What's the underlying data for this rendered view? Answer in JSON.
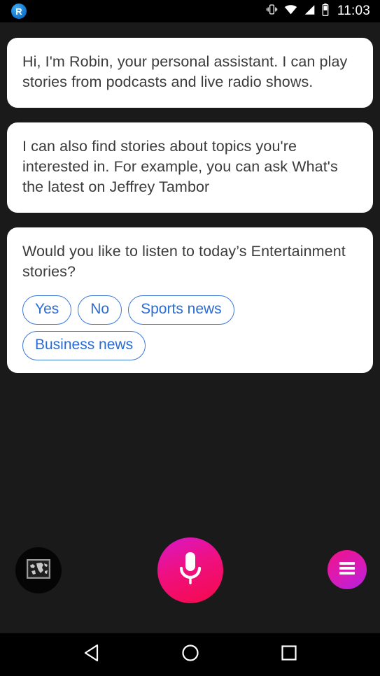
{
  "status_bar": {
    "app_badge_letter": "R",
    "app_badge_name": "robin-app-icon",
    "icons": [
      "vibrate-icon",
      "wifi-icon",
      "cellular-signal-icon",
      "battery-icon"
    ],
    "clock": "11:03"
  },
  "conversation": {
    "messages": [
      {
        "text": "Hi, I'm Robin, your personal assistant. I can play stories from podcasts and live radio shows.",
        "chips": []
      },
      {
        "text": "I can also find stories about topics you're interested in. For example, you can ask What's the latest on Jeffrey Tambor",
        "chips": []
      },
      {
        "text": "Would you like to listen to today’s Entertainment stories?",
        "chips": [
          "Yes",
          "No",
          "Sports news",
          "Business news"
        ]
      }
    ]
  },
  "controls": {
    "map_button": {
      "icon": "world-map-icon",
      "label": "Map"
    },
    "mic_button": {
      "icon": "microphone-icon",
      "label": "Microphone"
    },
    "menu_button": {
      "icon": "hamburger-menu-icon",
      "label": "Menu"
    }
  },
  "nav_bar": {
    "back": "back-triangle-icon",
    "home": "home-circle-icon",
    "recents": "recents-square-icon"
  },
  "colors": {
    "background": "#1a1a1a",
    "status_bar": "#000000",
    "bubble": "#ffffff",
    "bubble_text": "#3b3b3b",
    "chip_accent": "#2b6cd4",
    "mic_gradient_start": "#d817c8",
    "mic_gradient_end": "#f5094b",
    "menu_gradient_start": "#f01287",
    "menu_gradient_end": "#b221e0",
    "app_badge": "#1a7fd4"
  }
}
